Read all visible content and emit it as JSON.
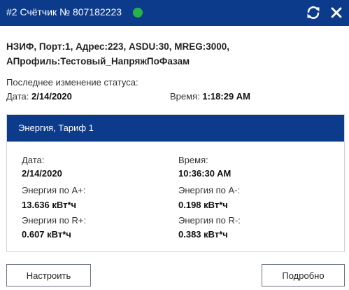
{
  "window": {
    "title": "#2 Счётчик № 807182223",
    "status_color": "#27b34a",
    "accent_color": "#0c3b8c",
    "refresh_icon": "refresh-icon",
    "close_icon": "close-icon"
  },
  "device": {
    "line1": "НЗИФ, Порт:1, Адрес:223, ASDU:30, MREG:3000,",
    "line2": "АПрофиль:Тестовый_НапряжПоФазам"
  },
  "status_change": {
    "heading": "Последнее изменение статуса:",
    "date_label": "Дата:",
    "date_value": "2/14/2020",
    "time_label": "Время:",
    "time_value": "1:18:29 AM"
  },
  "energy_panel": {
    "title": "Энергия, Тариф 1",
    "date_label": "Дата:",
    "date_value": "2/14/2020",
    "time_label": "Время:",
    "time_value": "10:36:30 AM",
    "a_plus_label": "Энергия по A+:",
    "a_plus_value": "13.636 кВт*ч",
    "a_minus_label": "Энергия по A-:",
    "a_minus_value": "0.198 кВт*ч",
    "r_plus_label": "Энергия по R+:",
    "r_plus_value": "0.607 кВт*ч",
    "r_minus_label": "Энергия по R-:",
    "r_minus_value": "0.383 кВт*ч"
  },
  "buttons": {
    "configure": "Настроить",
    "details": "Подробно"
  }
}
